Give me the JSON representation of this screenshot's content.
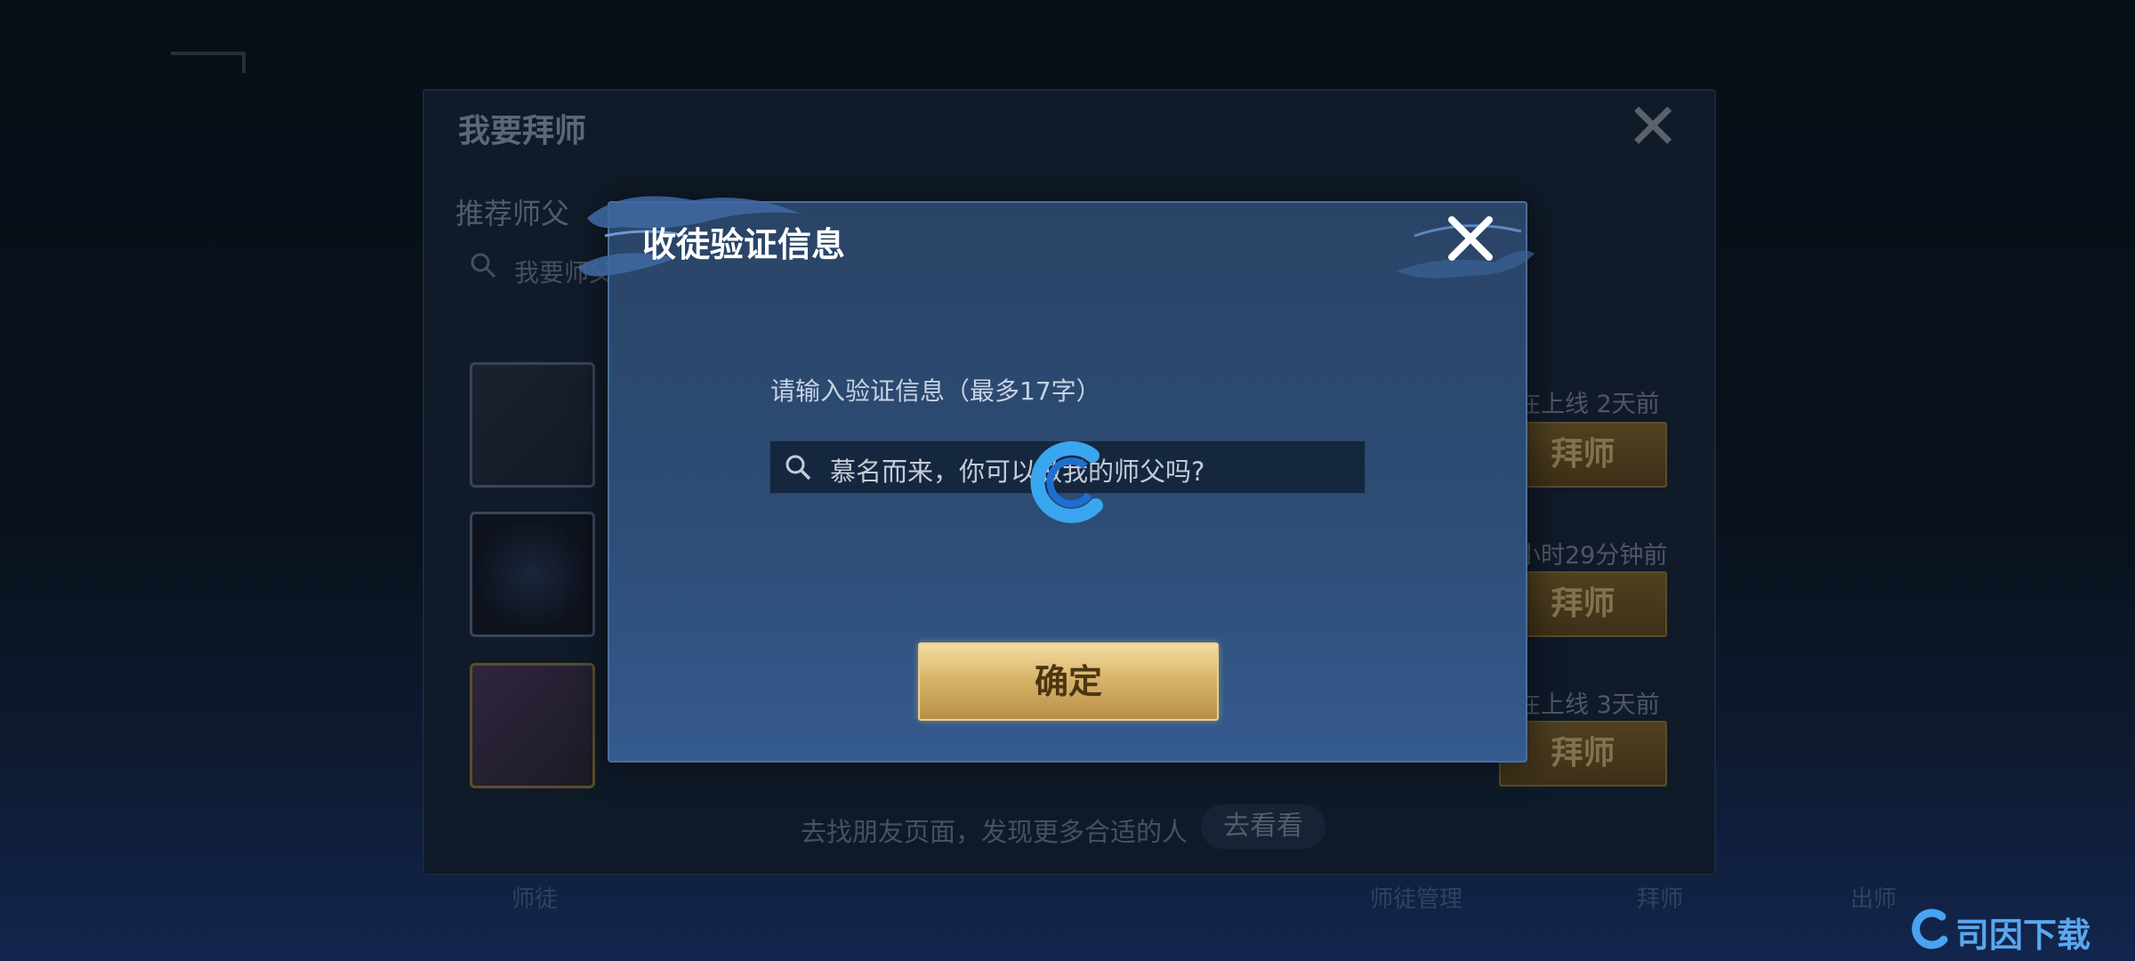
{
  "background_panel": {
    "title": "我要拜师",
    "subtitle": "推荐师父",
    "search_placeholder": "我要师父",
    "rows": [
      {
        "online": "在上线 2天前",
        "button": "拜师"
      },
      {
        "online": "小时29分钟前",
        "button": "拜师"
      },
      {
        "online": "在上线 3天前",
        "button": "拜师"
      }
    ],
    "footer_tip": "去找朋友页面，发现更多合适的人",
    "footer_button": "去看看"
  },
  "dialog": {
    "title": "收徒验证信息",
    "prompt": "请输入验证信息（最多17字）",
    "input_value": "慕名而来，你可以做我的师父吗?",
    "confirm_label": "确定"
  },
  "bottom_nav": [
    "师徒",
    "师徒管理",
    "拜师",
    "出师"
  ],
  "watermark": "司因下载",
  "colors": {
    "confirm_gold": "#d9b56c",
    "dialog_blue": "#2d4c75",
    "accent_blue": "#5aa7f0"
  },
  "icons": [
    "close-icon",
    "search-icon",
    "loading-spinner-icon",
    "watermark-logo-icon"
  ]
}
